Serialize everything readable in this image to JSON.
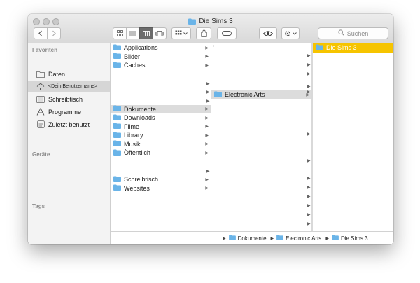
{
  "window": {
    "title": "Die Sims 3"
  },
  "toolbar": {
    "back_icon": "chevron-left-icon",
    "forward_icon": "chevron-right-icon",
    "view_modes": [
      "icon-view-icon",
      "list-view-icon",
      "column-view-icon",
      "cover-flow-icon"
    ],
    "active_view": "column-view-icon",
    "search_placeholder": "Suchen"
  },
  "sidebar": {
    "favorites_label": "Favoriten",
    "devices_label": "Geräte",
    "tags_label": "Tags",
    "items": [
      {
        "label": "Daten",
        "icon": "folder-icon"
      },
      {
        "label": "<Dein Benutzername>",
        "icon": "home-icon"
      },
      {
        "label": "Schreibtisch",
        "icon": "desktop-icon"
      },
      {
        "label": "Programme",
        "icon": "applications-icon"
      },
      {
        "label": "Zuletzt benutzt",
        "icon": "recents-icon"
      }
    ]
  },
  "column1": {
    "items": [
      {
        "label": "Applications"
      },
      {
        "label": "Bilder"
      },
      {
        "label": "Caches"
      },
      {
        "label": "Dokumente"
      },
      {
        "label": "Downloads"
      },
      {
        "label": "Filme"
      },
      {
        "label": "Library"
      },
      {
        "label": "Musik"
      },
      {
        "label": "Öffentlich"
      },
      {
        "label": "Schreibtisch"
      },
      {
        "label": "Websites"
      }
    ],
    "selected": "Dokumente"
  },
  "column2": {
    "items": [
      {
        "label": "Electronic Arts"
      }
    ],
    "selected": "Electronic Arts"
  },
  "column3": {
    "items": [
      {
        "label": "Die Sims 3"
      }
    ],
    "selected": "Die Sims 3"
  },
  "pathbar": {
    "crumbs": [
      "Dokumente",
      "Electronic Arts",
      "Die Sims 3"
    ]
  },
  "colors": {
    "selection_active": "#f6c400",
    "selection_inactive": "#dcdcdc",
    "folder_blue": "#6ab4e8"
  }
}
